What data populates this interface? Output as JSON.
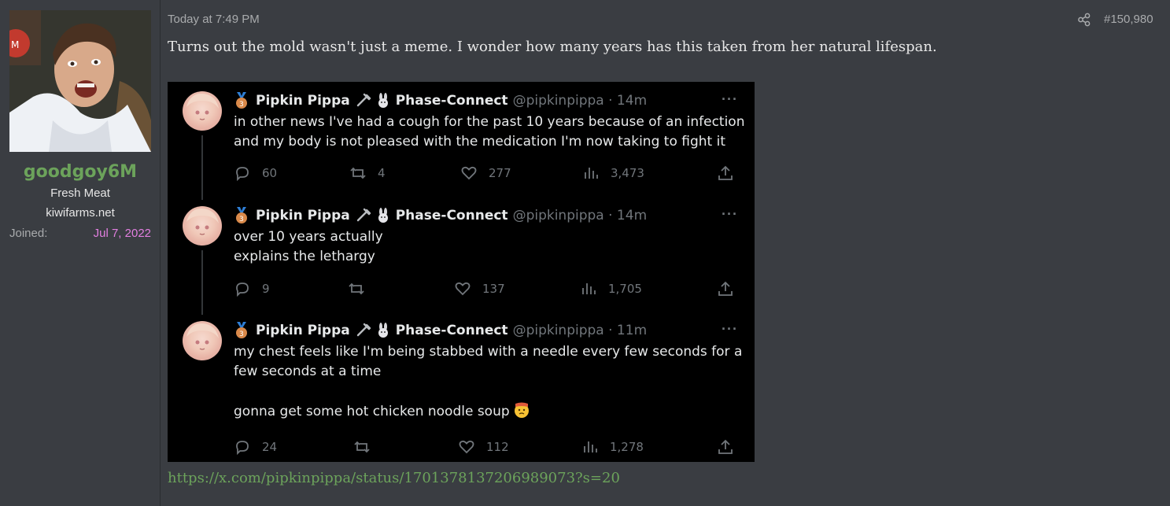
{
  "user": {
    "username": "goodgoy6M",
    "title": "Fresh Meat",
    "site": "kiwifarms.net",
    "joined_label": "Joined:",
    "joined_value": "Jul 7, 2022",
    "username_color": "#6ca35b",
    "joined_color": "#e27fe0"
  },
  "post": {
    "timestamp": "Today at 7:49 PM",
    "number": "#150,980",
    "text": "Turns out the mold wasn't just a meme. I wonder how many years has this taken from her natural lifespan.",
    "link": "https://x.com/pipkinpippa/status/1701378137206989073?s=20"
  },
  "tweets": [
    {
      "name": "Pipkin Pippa",
      "affiliation": "Phase-Connect",
      "handle_time": "@pipkinpippa · 14m",
      "lines": [
        "in other news I've had a cough for the past 10 years because of an infection",
        "and my body is not pleased with the medication I'm now taking to fight it"
      ],
      "replies": "60",
      "retweets": "4",
      "likes": "277",
      "views": "3,473"
    },
    {
      "name": "Pipkin Pippa",
      "affiliation": "Phase-Connect",
      "handle_time": "@pipkinpippa · 14m",
      "lines": [
        "over 10 years actually",
        "explains the lethargy"
      ],
      "replies": "9",
      "retweets": "",
      "likes": "137",
      "views": "1,705"
    },
    {
      "name": "Pipkin Pippa",
      "affiliation": "Phase-Connect",
      "handle_time": "@pipkinpippa · 11m",
      "lines": [
        "my chest feels like I'm being stabbed with a needle every few seconds for a",
        "few seconds at a time",
        "",
        "gonna get some hot chicken noodle soup"
      ],
      "replies": "24",
      "retweets": "",
      "likes": "112",
      "views": "1,278"
    }
  ],
  "icons": {
    "share": "share-icon",
    "medal": "bronze-medal-icon",
    "plug": "plug-icon",
    "bunny": "rabbit-icon",
    "reply": "reply-icon",
    "retweet": "retweet-icon",
    "like": "heart-icon",
    "views": "views-icon",
    "upload": "upload-icon",
    "more": "more-icon",
    "emoji": "thermometer-face-emoji"
  }
}
